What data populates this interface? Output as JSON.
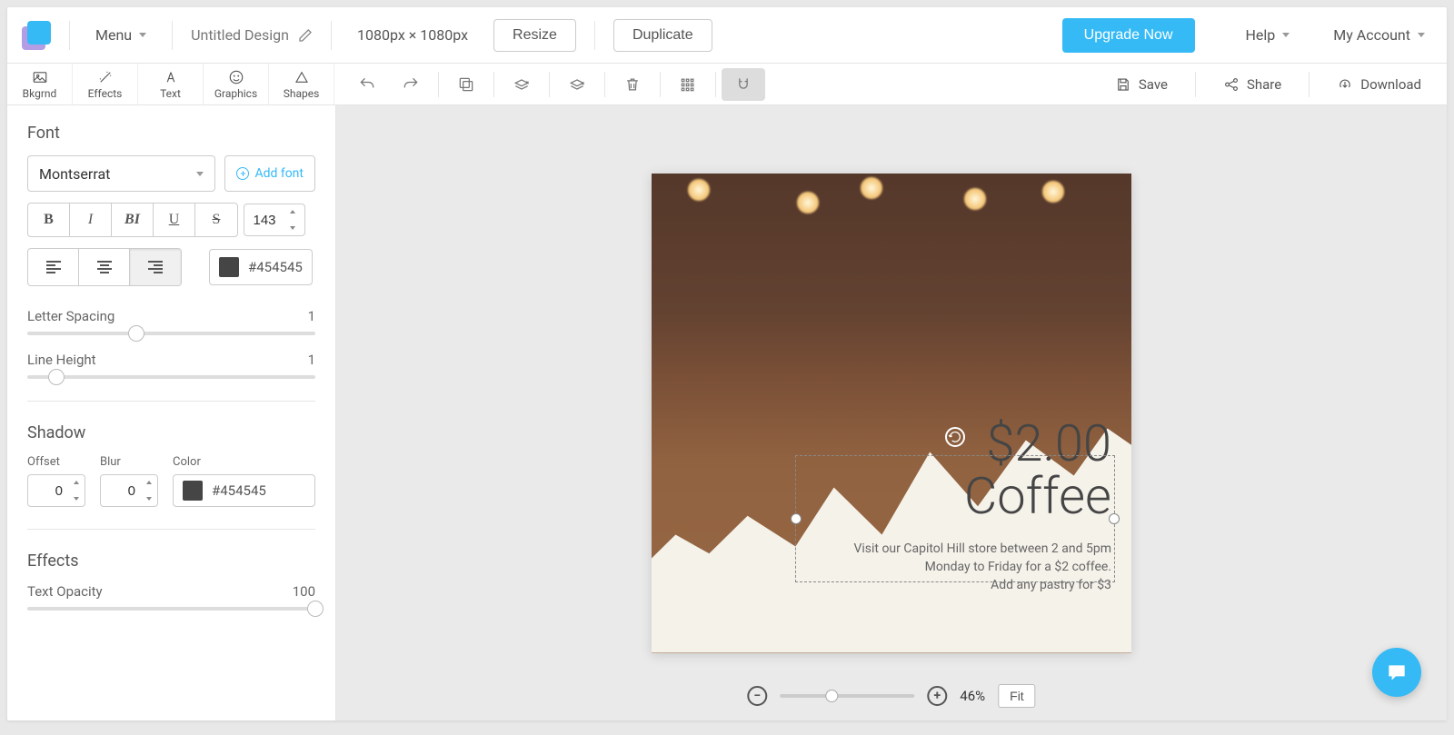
{
  "topbar": {
    "menu": "Menu",
    "title": "Untitled Design",
    "dimensions": "1080px × 1080px",
    "resize": "Resize",
    "duplicate": "Duplicate",
    "upgrade": "Upgrade Now",
    "help": "Help",
    "account": "My Account"
  },
  "tabs": {
    "bkgrnd": "Bkgrnd",
    "effects": "Effects",
    "text": "Text",
    "graphics": "Graphics",
    "shapes": "Shapes"
  },
  "toolbar": {
    "save": "Save",
    "share": "Share",
    "download": "Download"
  },
  "panel": {
    "font_section": "Font",
    "font_name": "Montserrat",
    "add_font": "Add font",
    "font_size": "143",
    "color_hex": "#454545",
    "letter_spacing_label": "Letter Spacing",
    "letter_spacing_value": "1",
    "line_height_label": "Line Height",
    "line_height_value": "1",
    "shadow_section": "Shadow",
    "offset_label": "Offset",
    "offset_value": "0",
    "blur_label": "Blur",
    "blur_value": "0",
    "shadow_color_label": "Color",
    "shadow_color_hex": "#454545",
    "effects_section": "Effects",
    "text_opacity_label": "Text Opacity",
    "text_opacity_value": "100"
  },
  "canvas": {
    "heading_line1": "$2.00",
    "heading_line2": "Coffee",
    "sub_line1": "Visit our Capitol Hill store between 2 and 5pm",
    "sub_line2": "Monday to Friday for a $2 coffee.",
    "sub_line3": "Add any pastry for $3"
  },
  "zoom": {
    "percent": "46%",
    "fit": "Fit"
  }
}
